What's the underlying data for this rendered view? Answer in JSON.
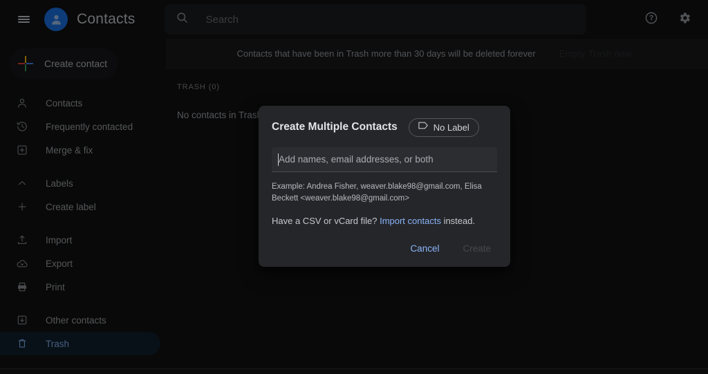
{
  "app": {
    "title": "Contacts",
    "accent_color": "#8ab4f8",
    "avatar_color": "#1a73e8",
    "background_color": "#121212",
    "dialog_color": "#25262a"
  },
  "appbar": {
    "menu_icon": "hamburger-menu-icon",
    "avatar_icon": "person-avatar-icon",
    "search": {
      "icon": "search-icon",
      "placeholder": "Search",
      "value": ""
    },
    "actions": [
      {
        "name": "help-icon",
        "label": "Help"
      },
      {
        "name": "settings-icon",
        "label": "Settings"
      }
    ]
  },
  "sidebar": {
    "create_contact": {
      "label": "Create contact",
      "icon": "google-plus-icon"
    },
    "items": [
      {
        "label": "Contacts",
        "icon": "person-icon",
        "active": false
      },
      {
        "label": "Frequently contacted",
        "icon": "history-clock-icon",
        "active": false
      },
      {
        "label": "Merge & fix",
        "icon": "merge-fix-icon",
        "active": false
      },
      {
        "label": "Labels",
        "icon": "chevron-up-icon",
        "active": false
      },
      {
        "label": "Create label",
        "icon": "plus-icon",
        "active": false
      },
      {
        "label": "Import",
        "icon": "upload-icon",
        "active": false
      },
      {
        "label": "Export",
        "icon": "cloud-download-icon",
        "active": false
      },
      {
        "label": "Print",
        "icon": "printer-icon",
        "active": false
      },
      {
        "label": "Other contacts",
        "icon": "box-arrow-down-icon",
        "active": false
      },
      {
        "label": "Trash",
        "icon": "trash-icon",
        "active": true
      }
    ]
  },
  "main": {
    "banner": {
      "text": "Contacts that have been in Trash more than 30 days will be deleted forever",
      "action_label": "Empty Trash now"
    },
    "section_header": "TRASH (0)",
    "empty_message": "No contacts in Trash"
  },
  "dialog": {
    "title": "Create Multiple Contacts",
    "label_chip": {
      "icon": "label-tag-icon",
      "text": "No Label"
    },
    "names_field": {
      "placeholder": "Add names, email addresses, or both",
      "value": ""
    },
    "example_text": "Example: Andrea Fisher, weaver.blake98@gmail.com, Elisa Beckett <weaver.blake98@gmail.com>",
    "csv_prefix": "Have a CSV or vCard file? ",
    "csv_link": "Import contacts",
    "csv_suffix": " instead.",
    "cancel_label": "Cancel",
    "create_label": "Create"
  }
}
